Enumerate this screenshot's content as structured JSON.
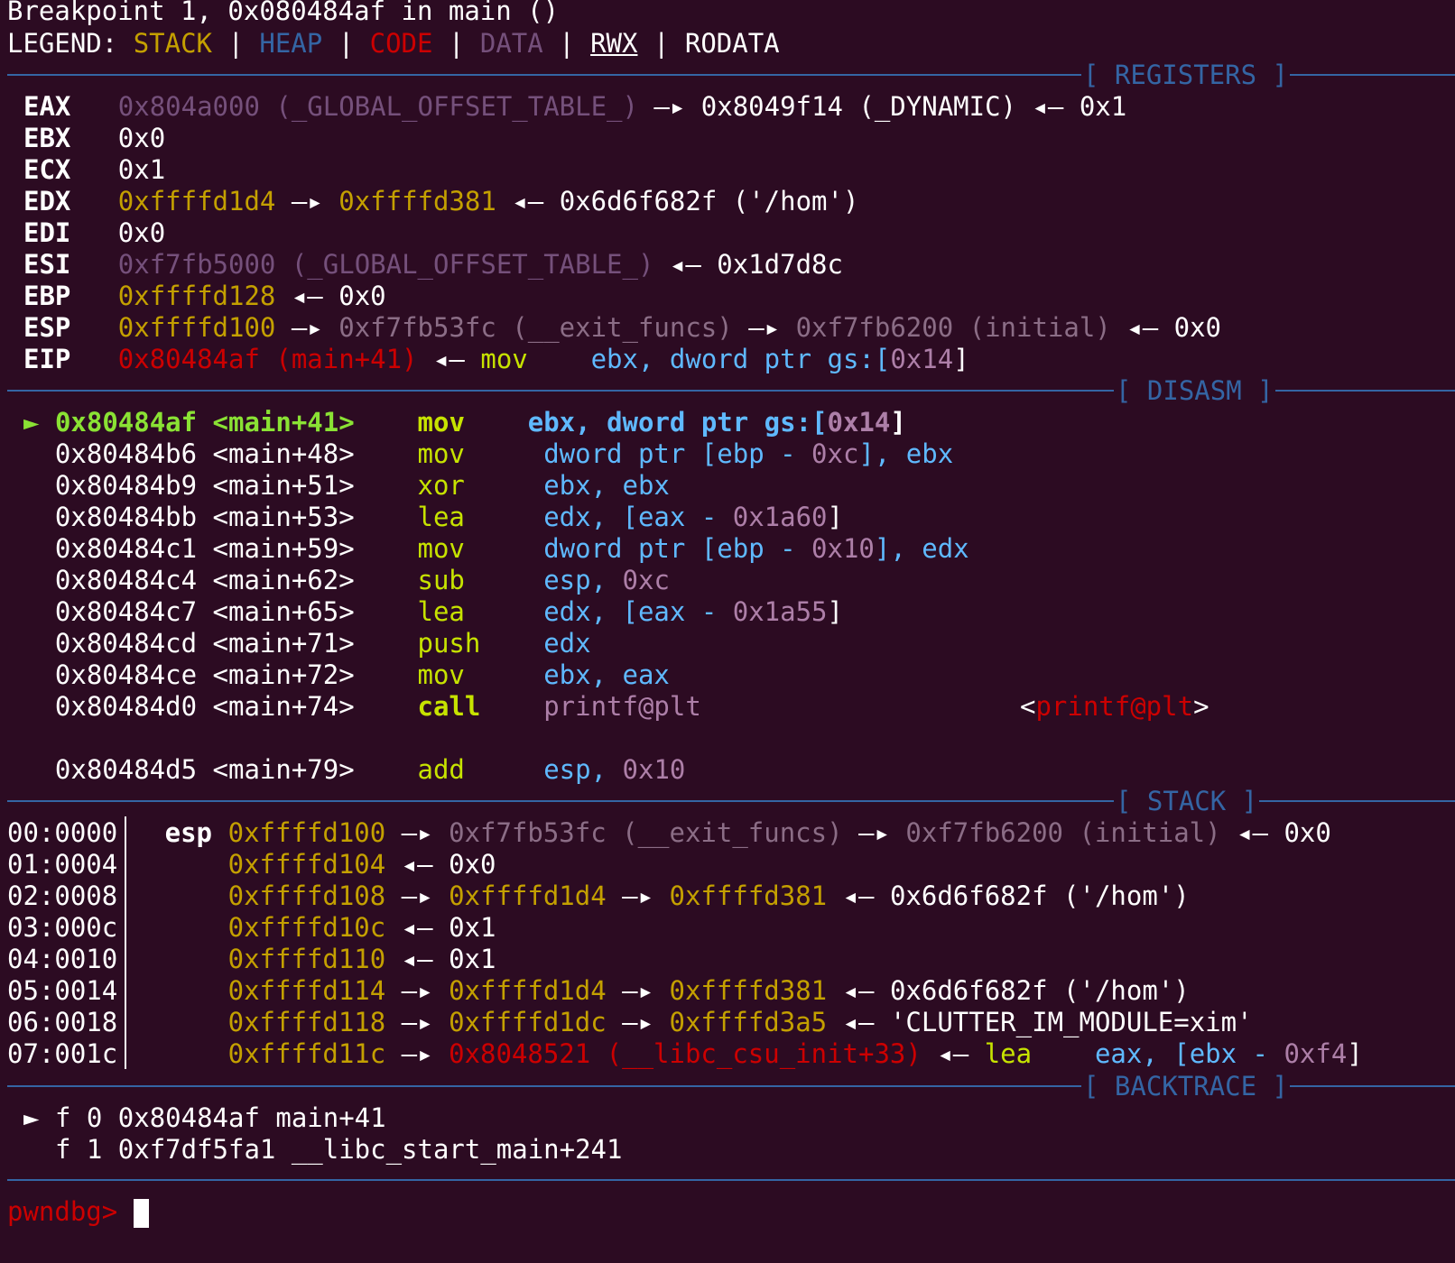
{
  "header": {
    "breakpoint": "Breakpoint 1, 0x080484af in main ()",
    "legend_label": "LEGEND: ",
    "legend": [
      "STACK",
      "HEAP",
      "CODE",
      "DATA",
      "RWX",
      "RODATA"
    ],
    "legend_sep": " | "
  },
  "sections": {
    "registers": "[ REGISTERS ]",
    "disasm": "[ DISASM ]",
    "stack": "[ STACK ]",
    "backtrace": "[ BACKTRACE ]"
  },
  "registers": {
    "eax": {
      "name": "EAX",
      "addr": "0x804a000",
      "sym": " (_GLOBAL_OFFSET_TABLE_)",
      "arrow": " —▸ ",
      "ptr": "0x8049f14 (_DYNAMIC)",
      "back": " ◂— ",
      "val": "0x1"
    },
    "ebx": {
      "name": "EBX",
      "val": "0x0"
    },
    "ecx": {
      "name": "ECX",
      "val": "0x1"
    },
    "edx": {
      "name": "EDX",
      "addr": "0xffffd1d4",
      "arrow": " —▸ ",
      "ptr": "0xffffd381",
      "back": " ◂— ",
      "val": "0x6d6f682f ('/hom')"
    },
    "edi": {
      "name": "EDI",
      "val": "0x0"
    },
    "esi": {
      "name": "ESI",
      "addr": "0xf7fb5000",
      "sym": " (_GLOBAL_OFFSET_TABLE_)",
      "back": " ◂— ",
      "val": "0x1d7d8c"
    },
    "ebp": {
      "name": "EBP",
      "addr": "0xffffd128",
      "back": " ◂— ",
      "val": "0x0"
    },
    "esp": {
      "name": "ESP",
      "addr": "0xffffd100",
      "arrow": " —▸ ",
      "ptr": "0xf7fb53fc (__exit_funcs)",
      "arrow2": " —▸ ",
      "ptr2": "0xf7fb6200 (initial)",
      "back": " ◂— ",
      "val": "0x0"
    },
    "eip": {
      "name": "EIP",
      "addr": "0x80484af (main+41)",
      "back": " ◂— ",
      "mn": "mov",
      "op1": "ebx, ",
      "op2": "dword ptr gs:[",
      "num": "0x14",
      "close": "]"
    }
  },
  "disasm": [
    {
      "addr": "0x80484af",
      "sym": "<main+41>",
      "mn": "mov",
      "ops": [
        "ebx, ",
        "dword ptr gs:[",
        "0x14",
        "]"
      ]
    },
    {
      "addr": "0x80484b6",
      "sym": "<main+48>",
      "mn": "mov",
      "ops": [
        "dword ptr [ebp - ",
        "0xc",
        "], ebx"
      ]
    },
    {
      "addr": "0x80484b9",
      "sym": "<main+51>",
      "mn": "xor",
      "ops": [
        "ebx, ebx"
      ]
    },
    {
      "addr": "0x80484bb",
      "sym": "<main+53>",
      "mn": "lea",
      "ops": [
        "edx, [eax - ",
        "0x1a60",
        "]"
      ]
    },
    {
      "addr": "0x80484c1",
      "sym": "<main+59>",
      "mn": "mov",
      "ops": [
        "dword ptr [ebp - ",
        "0x10",
        "], edx"
      ]
    },
    {
      "addr": "0x80484c4",
      "sym": "<main+62>",
      "mn": "sub",
      "ops": [
        "esp, ",
        "0xc"
      ]
    },
    {
      "addr": "0x80484c7",
      "sym": "<main+65>",
      "mn": "lea",
      "ops": [
        "edx, [eax - ",
        "0x1a55",
        "]"
      ]
    },
    {
      "addr": "0x80484cd",
      "sym": "<main+71>",
      "mn": "push",
      "ops": [
        "edx"
      ]
    },
    {
      "addr": "0x80484ce",
      "sym": "<main+72>",
      "mn": "mov",
      "ops": [
        "ebx, eax"
      ]
    },
    {
      "addr": "0x80484d0",
      "sym": "<main+74>",
      "mn": "call",
      "ops": [
        "printf@plt"
      ],
      "target_open": "<",
      "target": "printf@plt",
      "target_close": ">"
    },
    {
      "addr": "0x80484d5",
      "sym": "<main+79>",
      "mn": "add",
      "ops": [
        "esp, ",
        "0x10"
      ]
    }
  ],
  "disasm_marker": "►",
  "stack": [
    {
      "idx": "00:0000",
      "reg": "esp",
      "addr": "0xffffd100",
      "rest": [
        {
          "t": " —▸ ",
          "c": "w"
        },
        {
          "t": "0xf7fb53fc (__exit_funcs)",
          "c": "gray"
        },
        {
          "t": " —▸ ",
          "c": "w"
        },
        {
          "t": "0xf7fb6200 (initial)",
          "c": "gray"
        },
        {
          "t": " ◂— ",
          "c": "w"
        },
        {
          "t": "0x0",
          "c": "w"
        }
      ]
    },
    {
      "idx": "01:0004",
      "reg": "",
      "addr": "0xffffd104",
      "rest": [
        {
          "t": " ◂— ",
          "c": "w"
        },
        {
          "t": "0x0",
          "c": "w"
        }
      ]
    },
    {
      "idx": "02:0008",
      "reg": "",
      "addr": "0xffffd108",
      "rest": [
        {
          "t": " —▸ ",
          "c": "w"
        },
        {
          "t": "0xffffd1d4",
          "c": "stack"
        },
        {
          "t": " —▸ ",
          "c": "w"
        },
        {
          "t": "0xffffd381",
          "c": "stack"
        },
        {
          "t": " ◂— ",
          "c": "w"
        },
        {
          "t": "0x6d6f682f ('/hom')",
          "c": "w"
        }
      ]
    },
    {
      "idx": "03:000c",
      "reg": "",
      "addr": "0xffffd10c",
      "rest": [
        {
          "t": " ◂— ",
          "c": "w"
        },
        {
          "t": "0x1",
          "c": "w"
        }
      ]
    },
    {
      "idx": "04:0010",
      "reg": "",
      "addr": "0xffffd110",
      "rest": [
        {
          "t": " ◂— ",
          "c": "w"
        },
        {
          "t": "0x1",
          "c": "w"
        }
      ]
    },
    {
      "idx": "05:0014",
      "reg": "",
      "addr": "0xffffd114",
      "rest": [
        {
          "t": " —▸ ",
          "c": "w"
        },
        {
          "t": "0xffffd1d4",
          "c": "stack"
        },
        {
          "t": " —▸ ",
          "c": "w"
        },
        {
          "t": "0xffffd381",
          "c": "stack"
        },
        {
          "t": " ◂— ",
          "c": "w"
        },
        {
          "t": "0x6d6f682f ('/hom')",
          "c": "w"
        }
      ]
    },
    {
      "idx": "06:0018",
      "reg": "",
      "addr": "0xffffd118",
      "rest": [
        {
          "t": " —▸ ",
          "c": "w"
        },
        {
          "t": "0xffffd1dc",
          "c": "stack"
        },
        {
          "t": " —▸ ",
          "c": "w"
        },
        {
          "t": "0xffffd3a5",
          "c": "stack"
        },
        {
          "t": " ◂— ",
          "c": "w"
        },
        {
          "t": "'CLUTTER_IM_MODULE=xim'",
          "c": "w"
        }
      ]
    },
    {
      "idx": "07:001c",
      "reg": "",
      "addr": "0xffffd11c",
      "rest": [
        {
          "t": " —▸ ",
          "c": "w"
        },
        {
          "t": "0x8048521 (__libc_csu_init+33)",
          "c": "code"
        },
        {
          "t": " ◂— ",
          "c": "w"
        },
        {
          "t": "lea",
          "c": "mn"
        },
        {
          "t": "    ",
          "c": "w"
        },
        {
          "t": "eax, [ebx - ",
          "c": "reg"
        },
        {
          "t": "0xf4",
          "c": "num"
        },
        {
          "t": "]",
          "c": "w"
        }
      ]
    }
  ],
  "backtrace": [
    {
      "marker": "►",
      "text": "f 0 0x80484af main+41"
    },
    {
      "marker": " ",
      "text": "f 1 0xf7df5fa1 __libc_start_main+241"
    }
  ],
  "prompt": "pwndbg> ",
  "colors": {
    "background": "#2c0b22",
    "stack": "#c4a000",
    "heap": "#3465a4",
    "code": "#cc0000",
    "data": "#75507b",
    "separator": "#3465a4",
    "pointer_green": "#8ae234"
  }
}
